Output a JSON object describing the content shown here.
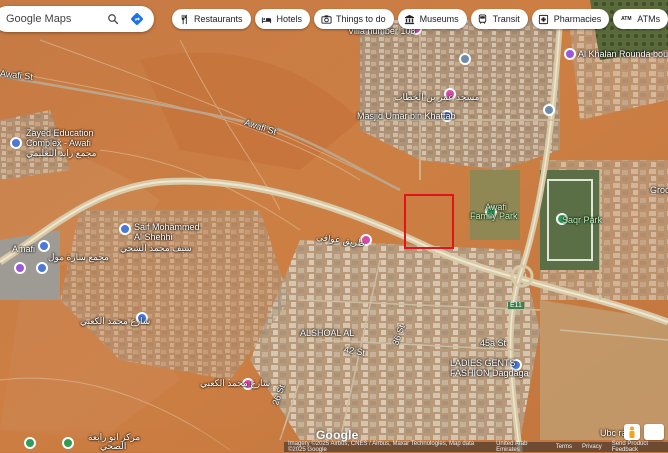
{
  "search": {
    "placeholder": "Google Maps"
  },
  "chips": [
    {
      "label": "Restaurants",
      "icon": "fork-knife-icon"
    },
    {
      "label": "Hotels",
      "icon": "bed-icon"
    },
    {
      "label": "Things to do",
      "icon": "camera-icon"
    },
    {
      "label": "Museums",
      "icon": "museum-icon"
    },
    {
      "label": "Transit",
      "icon": "train-icon"
    },
    {
      "label": "Pharmacies",
      "icon": "pharmacy-icon"
    },
    {
      "label": "ATMs",
      "icon": "atm-icon"
    }
  ],
  "map_labels": {
    "villa": "Villa number 108",
    "alkhalan": "Al Khalan Rounda bout",
    "masjid_ar": "مسجد عمر بن الخطاب",
    "masjid": "Masjid Umar bin Khattab",
    "awafi_st_left": "Awafi St",
    "awafi_st": "Awafi St",
    "zayed_1": "Zayed Education",
    "zayed_2": "Complex - Awafi",
    "zayed_ar": "مجمع زايد التعليمي",
    "left_edge": "Amafi",
    "said_1": "Saif Mohammed",
    "said_2": "Al Shehhi",
    "said_ar": "سيف محمد الشحي",
    "road_ar": "طريق عوافي",
    "awafi_park_1": "Awafi",
    "awafi_park_2": "Family Park",
    "saqr_park": "Saqr Park",
    "grocery": "Groce",
    "left_ar_1": "مجمع سارة مول",
    "mohd_ar": "شارع محمد الكعبي",
    "shaabiya_1": "ALSHOAL AL",
    "road_45a": "45a St",
    "road_42": "42 St",
    "road_36": "36 St",
    "road_26": "26 St",
    "ladies_1": "LADIES GENTS",
    "ladies_2": "FASHION Dagdaga",
    "mohd_ar_2": "شارع محمد الكعبي",
    "bottom_ar_1": "مركز ابو رابعة",
    "bottom_ar_2": "الصحي",
    "ubc": "Ubc rant",
    "e18": "E18",
    "e11": "E11"
  },
  "footer": {
    "imagery": "Imagery ©2025 Airbus, CNES / Airbus, Maxar Technologies, Map data ©2025 Google",
    "region": "United Arab Emirates",
    "terms": "Terms",
    "privacy": "Privacy",
    "feedback": "Send Product Feedback"
  },
  "google_logo": "Google",
  "colors": {
    "selection": "#e0141a",
    "desert": "#c9793f",
    "road": "#d8c9a7"
  }
}
